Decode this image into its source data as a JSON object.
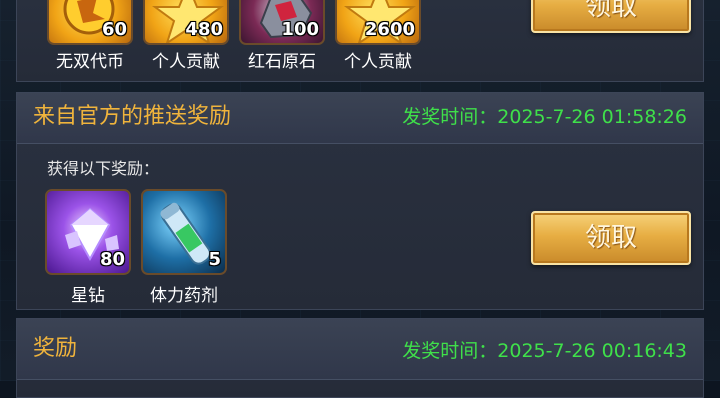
{
  "top_rewards": {
    "items": [
      {
        "qty": "60",
        "name": "无双代币",
        "icon": "coin-icon"
      },
      {
        "qty": "480",
        "name": "个人贡献",
        "icon": "star-icon"
      },
      {
        "qty": "100",
        "name": "红石原石",
        "icon": "ore-icon"
      },
      {
        "qty": "2600",
        "name": "个人贡献",
        "icon": "star-icon"
      }
    ],
    "claim_label": "领取"
  },
  "official_push": {
    "title": "来自官方的推送奖励",
    "time": "发奖时间：2025-7-26 01:58:26",
    "subtitle": "获得以下奖励：",
    "items": [
      {
        "qty": "80",
        "name": "星钻",
        "icon": "diamond-icon"
      },
      {
        "qty": "5",
        "name": "体力药剂",
        "icon": "potion-icon"
      }
    ],
    "claim_label": "领取"
  },
  "reward": {
    "title": "奖励",
    "time": "发奖时间：2025-7-26 00:16:43"
  }
}
